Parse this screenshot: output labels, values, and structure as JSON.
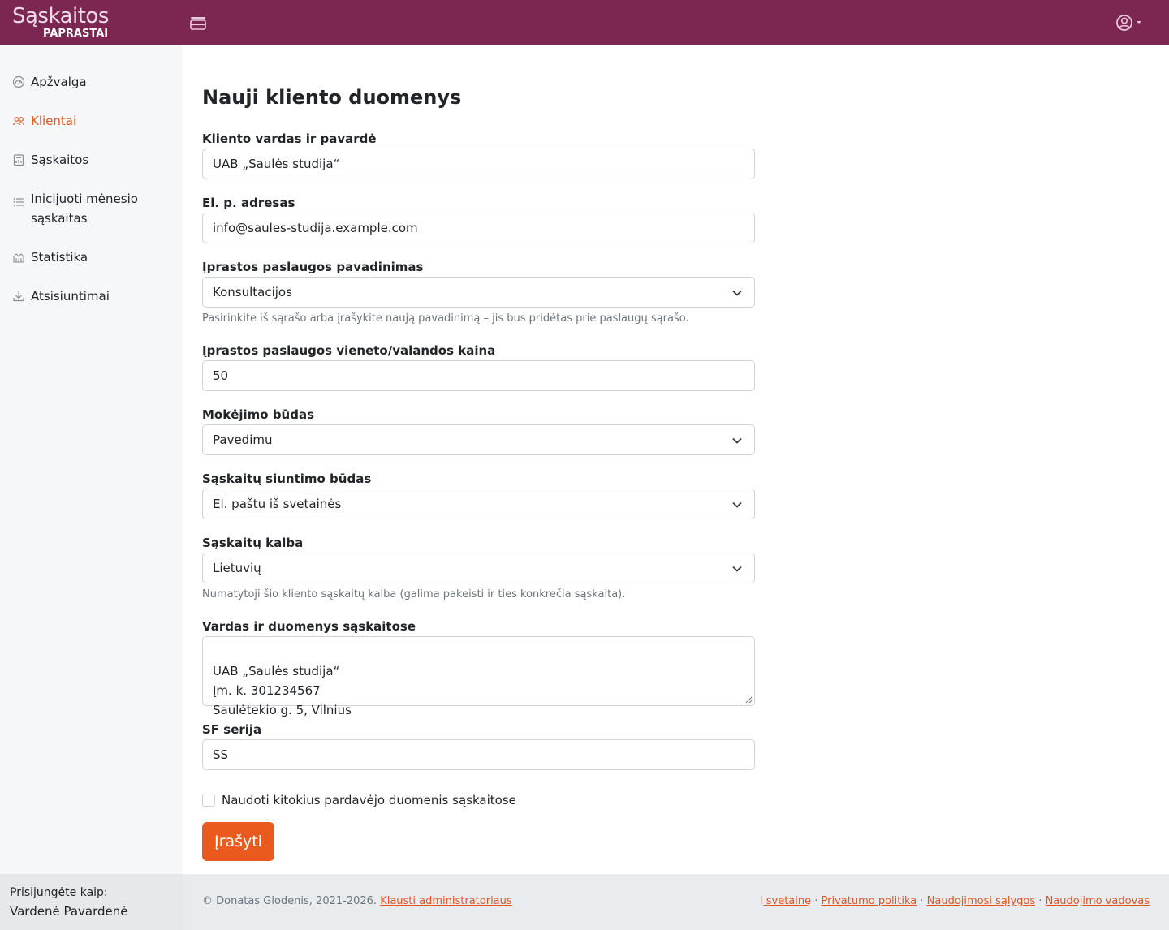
{
  "brand": {
    "top": "Sąskaitos",
    "bottom": "PAPRASTAI"
  },
  "header": {
    "menu_icon": "hamburger-icon",
    "user_icon": "user-circle-icon"
  },
  "colors": {
    "topbar": "#7b2752",
    "accent": "#e5531f",
    "button": "#ea5a1e"
  },
  "sidebar": {
    "items": [
      {
        "label": "Apžvalga",
        "icon": "dashboard-icon",
        "active": false
      },
      {
        "label": "Klientai",
        "icon": "users-icon",
        "active": true
      },
      {
        "label": "Sąskaitos",
        "icon": "receipt-icon",
        "active": false
      },
      {
        "label": "Inicijuoti mėnesio sąskaitas",
        "icon": "list-icon",
        "active": false
      },
      {
        "label": "Statistika",
        "icon": "chart-icon",
        "active": false
      },
      {
        "label": "Atsisiuntimai",
        "icon": "download-icon",
        "active": false
      }
    ]
  },
  "form": {
    "title": "Nauji kliento duomenys",
    "client_name": {
      "label": "Kliento vardas ir pavardė",
      "value": "UAB „Saulės studija“"
    },
    "email": {
      "label": "El. p. adresas",
      "value": "info@saules-studija.example.com"
    },
    "service_name": {
      "label": "Įprastos paslaugos pavadinimas",
      "value": "Konsultacijos",
      "help": "Pasirinkite iš sąrašo arba įrašykite naują pavadinimą – jis bus pridėtas prie paslaugų sąrašo."
    },
    "unit_price": {
      "label": "Įprastos paslaugos vieneto/valandos kaina",
      "value": "50"
    },
    "payment_method": {
      "label": "Mokėjimo būdas",
      "value": "Pavedimu"
    },
    "sending_method": {
      "label": "Sąskaitų siuntimo būdas",
      "value": "El. paštu iš svetainės"
    },
    "invoice_language": {
      "label": "Sąskaitų kalba",
      "value": "Lietuvių",
      "help": "Numatytoji šio kliento sąskaitų kalba (galima pakeisti ir ties konkrečia sąskaita)."
    },
    "invoice_details": {
      "label": "Vardas ir duomenys sąskaitose",
      "value": "UAB „Saulės studija“\nĮm. k. 301234567\nSaulėtekio g. 5, Vilnius"
    },
    "series": {
      "label": "SF serija",
      "value": "SS"
    },
    "alt_seller": {
      "label": "Naudoti kitokius pardavėjo duomenis sąskaitose",
      "checked": false
    },
    "save_label": "Įrašyti"
  },
  "footer": {
    "logged_label": "Prisijungėte kaip:",
    "user_name": "Vardenė Pavardenė",
    "copyright": "© Donatas Glodenis, 2021-2026.",
    "ask_admin": "Klausti administratoriaus",
    "links": [
      "Į svetainę",
      "Privatumo politika",
      "Naudojimosi sąlygos",
      "Naudojimo vadovas"
    ],
    "separator": " · "
  }
}
